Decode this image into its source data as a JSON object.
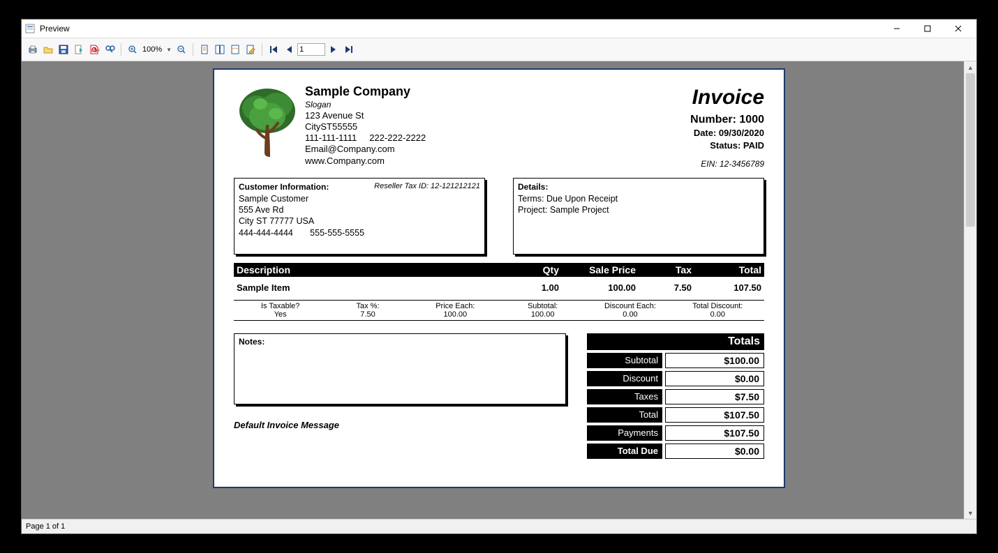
{
  "window": {
    "title": "Preview"
  },
  "toolbar": {
    "zoom_text": "100%",
    "page_value": "1"
  },
  "statusbar": {
    "text": "Page 1 of 1"
  },
  "company": {
    "name": "Sample Company",
    "slogan": "Slogan",
    "street": "123 Avenue St",
    "city_line": "CityST55555",
    "phone1": "111-111-1111",
    "phone2": "222-222-2222",
    "email": "Email@Company.com",
    "website": "www.Company.com"
  },
  "invoice": {
    "title": "Invoice",
    "number_label": "Number: 1000",
    "date_line": "Date: 09/30/2020",
    "status_line": "Status: PAID",
    "ein": "EIN: 12-3456789"
  },
  "customer": {
    "box_title": "Customer Information:",
    "reseller": "Reseller Tax ID: 12-121212121",
    "name": "Sample Customer",
    "street": "555 Ave Rd",
    "city": "City ST 77777 USA",
    "phone1": "444-444-4444",
    "phone2": "555-555-5555"
  },
  "details": {
    "box_title": "Details:",
    "terms": "Terms: Due Upon Receipt",
    "project": "Project: Sample Project"
  },
  "columns": {
    "desc": "Description",
    "qty": "Qty",
    "price": "Sale Price",
    "tax": "Tax",
    "total": "Total"
  },
  "items": [
    {
      "desc": "Sample Item",
      "qty": "1.00",
      "price": "100.00",
      "tax": "7.50",
      "total": "107.50"
    }
  ],
  "item_details": {
    "labels": {
      "taxable": "Is Taxable?",
      "tax_pct": "Tax %:",
      "price_each": "Price Each:",
      "subtotal": "Subtotal:",
      "disc_each": "Discount Each:",
      "total_disc": "Total Discount:"
    },
    "values": {
      "taxable": "Yes",
      "tax_pct": "7.50",
      "price_each": "100.00",
      "subtotal": "100.00",
      "disc_each": "0.00",
      "total_disc": "0.00"
    }
  },
  "notes": {
    "label": "Notes:"
  },
  "message": "Default Invoice Message",
  "totals": {
    "title": "Totals",
    "rows": [
      {
        "label": "Subtotal",
        "value": "$100.00",
        "bold": false
      },
      {
        "label": "Discount",
        "value": "$0.00",
        "bold": false
      },
      {
        "label": "Taxes",
        "value": "$7.50",
        "bold": false
      },
      {
        "label": "Total",
        "value": "$107.50",
        "bold": false
      },
      {
        "label": "Payments",
        "value": "$107.50",
        "bold": false
      },
      {
        "label": "Total Due",
        "value": "$0.00",
        "bold": true
      }
    ]
  }
}
